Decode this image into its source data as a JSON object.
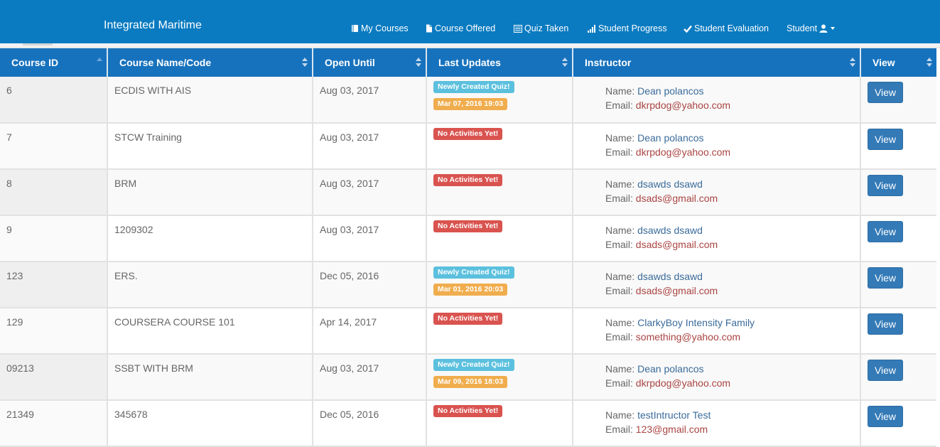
{
  "app": {
    "brand": "Integrated Maritime"
  },
  "nav": {
    "my_courses": "My Courses",
    "course_offered": "Course Offered",
    "quiz_taken": "Quiz Taken",
    "student_progress": "Student Progress",
    "student_evaluation": "Student Evaluation",
    "student_menu": "Student"
  },
  "table": {
    "headers": [
      "Course ID",
      "Course Name/Code",
      "Open Until",
      "Last Updates",
      "Instructor",
      "View"
    ],
    "name_label": "Name:",
    "email_label": "Email:",
    "view_label": "View",
    "rows": [
      {
        "id": "6",
        "name": "ECDIS WITH AIS",
        "open_until": "Aug 03, 2017",
        "updates": [
          {
            "text": "Newly Created Quiz!",
            "type": "info"
          },
          {
            "text": "Mar 07, 2016 19:03",
            "type": "warn"
          }
        ],
        "instructor_name": "Dean polancos",
        "instructor_email": "dkrpdog@yahoo.com"
      },
      {
        "id": "7",
        "name": "STCW Training",
        "open_until": "Aug 03, 2017",
        "updates": [
          {
            "text": "No Activities Yet!",
            "type": "danger"
          }
        ],
        "instructor_name": "Dean polancos",
        "instructor_email": "dkrpdog@yahoo.com"
      },
      {
        "id": "8",
        "name": "BRM",
        "open_until": "Aug 03, 2017",
        "updates": [
          {
            "text": "No Activities Yet!",
            "type": "danger"
          }
        ],
        "instructor_name": "dsawds dsawd",
        "instructor_email": "dsads@gmail.com"
      },
      {
        "id": "9",
        "name": "1209302",
        "open_until": "Aug 03, 2017",
        "updates": [
          {
            "text": "No Activities Yet!",
            "type": "danger"
          }
        ],
        "instructor_name": "dsawds dsawd",
        "instructor_email": "dsads@gmail.com"
      },
      {
        "id": "123",
        "name": "ERS.",
        "open_until": "Dec 05, 2016",
        "updates": [
          {
            "text": "Newly Created Quiz!",
            "type": "info"
          },
          {
            "text": "Mar 01, 2016 20:03",
            "type": "warn"
          }
        ],
        "instructor_name": "dsawds dsawd",
        "instructor_email": "dsads@gmail.com"
      },
      {
        "id": "129",
        "name": "COURSERA COURSE 101",
        "open_until": "Apr 14, 2017",
        "updates": [
          {
            "text": "No Activities Yet!",
            "type": "danger"
          }
        ],
        "instructor_name": "ClarkyBoy Intensity Family",
        "instructor_email": "something@yahoo.com"
      },
      {
        "id": "09213",
        "name": "SSBT WITH BRM",
        "open_until": "Aug 03, 2017",
        "updates": [
          {
            "text": "Newly Created Quiz!",
            "type": "info"
          },
          {
            "text": "Mar 09, 2016 18:03",
            "type": "warn"
          }
        ],
        "instructor_name": "Dean polancos",
        "instructor_email": "dkrpdog@yahoo.com"
      },
      {
        "id": "21349",
        "name": "345678",
        "open_until": "Dec 05, 2016",
        "updates": [
          {
            "text": "No Activities Yet!",
            "type": "danger"
          }
        ],
        "instructor_name": "testIntructor Test",
        "instructor_email": "123@gmail.com"
      }
    ]
  },
  "colors": {
    "navbar": "#0a7bc1",
    "header": "#1772bd",
    "badge_info": "#5bc0de",
    "badge_warn": "#f0ad4e",
    "badge_danger": "#d9534f",
    "button": "#337ab7"
  },
  "icons": {
    "my_courses": "book-icon",
    "course_offered": "file-icon",
    "quiz_taken": "list-alt-icon",
    "student_progress": "signal-bars-icon",
    "student_evaluation": "checkmark-icon",
    "student_menu": "user-icon"
  }
}
